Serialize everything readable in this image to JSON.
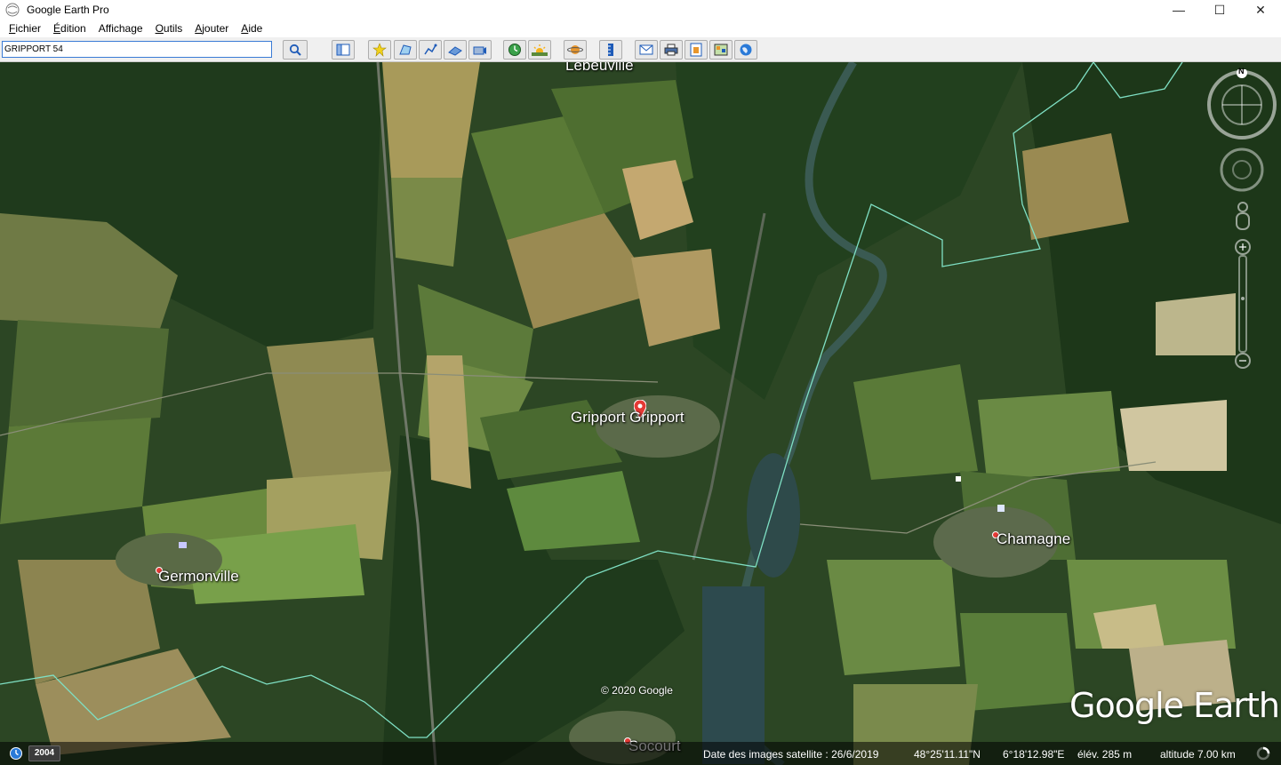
{
  "window": {
    "title": "Google Earth Pro",
    "minimize": "—",
    "maximize": "☐",
    "close": "✕"
  },
  "menu": {
    "items": [
      {
        "first": "F",
        "rest": "ichier"
      },
      {
        "first": "É",
        "rest": "dition"
      },
      {
        "first": "",
        "rest": "Affichage"
      },
      {
        "first": "O",
        "rest": "utils"
      },
      {
        "first": "A",
        "rest": "jouter"
      },
      {
        "first": "A",
        "rest": "ide"
      }
    ]
  },
  "search": {
    "value": "GRIPPORT 54"
  },
  "map": {
    "places": [
      {
        "name": "Lebeuville"
      },
      {
        "name": "Gripport Gripport"
      },
      {
        "name": "Germonville"
      },
      {
        "name": "Chamagne"
      },
      {
        "name": "Socourt"
      }
    ],
    "copyright": "© 2020 Google",
    "brand": "Google Earth",
    "north": "N"
  },
  "status": {
    "year": "2004",
    "imagery_date": "Date des images satellite : 26/6/2019",
    "latitude": "48°25'11.11\"N",
    "longitude": "6°18'12.98\"E",
    "elevation": "élév.  285 m",
    "altitude": "altitude   7.00 km"
  },
  "colors": {
    "boundary": "#7fe0c4",
    "forest": "#1f3a1c",
    "field_light": "#8f8a52",
    "river": "#3a5a52"
  }
}
